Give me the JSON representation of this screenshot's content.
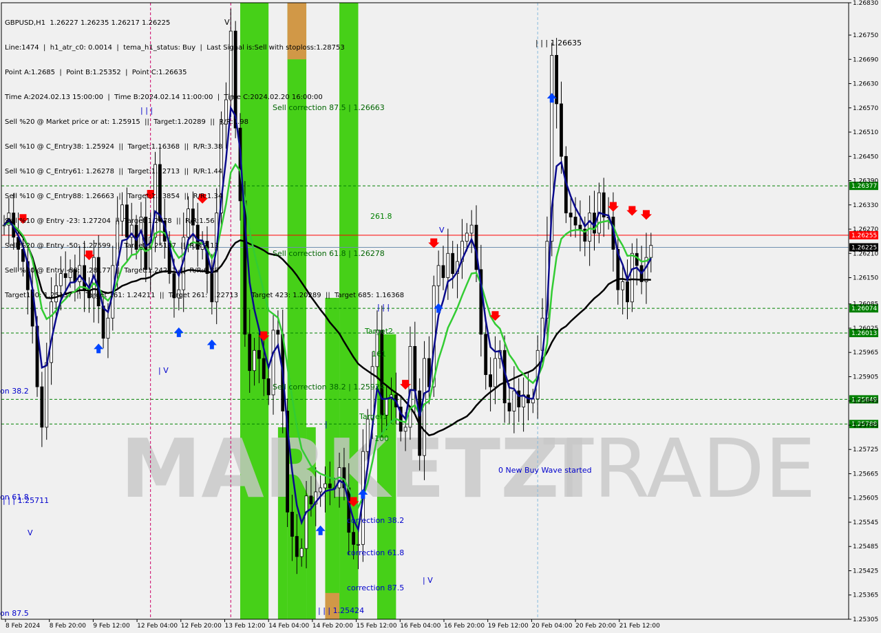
{
  "header": {
    "symbol_line": "GBPUSD,H1  1.26227 1.26235 1.26217 1.26225",
    "info_lines": [
      "Line:1474  |  h1_atr_c0: 0.0014  |  tema_h1_status: Buy  |  Last Signal is:Sell with stoploss:1.28753",
      "Point A:1.2685  |  Point B:1.25352  |  Point C:1.26635",
      "Time A:2024.02.13 15:00:00  |  Time B:2024.02.14 11:00:00  |  Time C:2024.02.20 16:00:00",
      "Sell %20 @ Market price or at: 1.25915  ||  Target:1.20289  ||  R/R:1.98",
      "Sell %10 @ C_Entry38: 1.25924  ||  Target:1.16368  ||  R/R:3.38",
      "Sell %10 @ C_Entry61: 1.26278  ||  Target:1.22713  ||  R/R:1.44",
      "Sell %10 @ C_Entry88: 1.26663  ||  Target:1.23854  ||  R/R:1.34",
      "Sell %10 @ Entry -23: 1.27204  ||  Target:1.2478  ||  R/R:1.56",
      "Sell %20 @ Entry -50: 1.27599  ||  Target:1.25137  ||  R/R:2.13",
      "Sell %20 @ Entry -88: 1.28177  ||  Target:1.24211  ||  R/R:6.89",
      "Target100: 1.25137  ||  Target 161: 1.24211  ||  Target 261: 1.22713  ||  Target 423: 1.20289  ||  Target 685: 1.16368"
    ]
  },
  "watermark": {
    "left": "MARKETZI",
    "right": "TRADE"
  },
  "colors": {
    "bull_candle": "#000000",
    "bear_candle": "#000000",
    "zone_green": "#33cc00",
    "zone_orange": "#d9954a",
    "ma_black": "#000000",
    "ma_navy": "#0a0a8c",
    "ma_green": "#33cc33",
    "level_green": "#008000",
    "level_red": "#ff0000",
    "level_grey": "#7090b0"
  },
  "annotations": [
    {
      "text": "Sell correction 87.5 | 1.26663",
      "color": "#006400"
    },
    {
      "text": "Sell correction 61.8 | 1.26278",
      "color": "#006400"
    },
    {
      "text": "Sell correction 38.2 | 1.25924",
      "color": "#006400"
    },
    {
      "text": "261.8",
      "color": "#008000"
    },
    {
      "text": "Target2",
      "color": "#008000"
    },
    {
      "text": "161",
      "color": "#008000"
    },
    {
      "text": "Target1",
      "color": "#008000"
    },
    {
      "text": "100",
      "color": "#008000"
    },
    {
      "text": "| | | 1.26635",
      "color": "#000000"
    },
    {
      "text": "| | | 1.25711",
      "color": "#0000cc"
    },
    {
      "text": "| | | 1.25424",
      "color": "#0000cc"
    },
    {
      "text": "0 New Buy Wave started",
      "color": "#0000cc"
    },
    {
      "text": "correction 38.2",
      "color": "#0000cc"
    },
    {
      "text": "correction 61.8",
      "color": "#0000cc"
    },
    {
      "text": "correction 87.5",
      "color": "#0000cc"
    },
    {
      "text": "on 38.2",
      "color": "#0000cc"
    },
    {
      "text": "on 61.8",
      "color": "#0000cc"
    },
    {
      "text": "on 87.5",
      "color": "#0000cc"
    },
    {
      "text": "| | |",
      "color": "#0000cc"
    },
    {
      "text": "| | |",
      "color": "#0000cc"
    },
    {
      "text": "| V",
      "color": "#0000cc"
    },
    {
      "text": "| V",
      "color": "#0000cc"
    },
    {
      "text": "V",
      "color": "#0000cc"
    },
    {
      "text": "V",
      "color": "#0000cc"
    },
    {
      "text": "V",
      "color": "#000000"
    },
    {
      "text": "|",
      "color": "#0000cc"
    }
  ],
  "chart_data": {
    "type": "candlestick",
    "symbol": "GBPUSD",
    "timeframe": "H1",
    "y_ticks": [
      "1.26830",
      "1.26750",
      "1.26690",
      "1.26630",
      "1.26570",
      "1.26510",
      "1.26450",
      "1.26390",
      "1.26330",
      "1.26270",
      "1.26210",
      "1.26150",
      "1.26085",
      "1.26025",
      "1.25965",
      "1.25905",
      "1.25845",
      "1.25785",
      "1.25725",
      "1.25665",
      "1.25605",
      "1.25545",
      "1.25485",
      "1.25425",
      "1.25365",
      "1.25305"
    ],
    "ylim": [
      1.25305,
      1.2683
    ],
    "x_ticks": [
      "8 Feb 2024",
      "8 Feb 20:00",
      "9 Feb 12:00",
      "12 Feb 04:00",
      "12 Feb 20:00",
      "13 Feb 12:00",
      "14 Feb 04:00",
      "14 Feb 20:00",
      "15 Feb 12:00",
      "16 Feb 04:00",
      "16 Feb 20:00",
      "19 Feb 12:00",
      "20 Feb 04:00",
      "20 Feb 20:00",
      "21 Feb 12:00"
    ],
    "price_levels": [
      {
        "label": "1.26377",
        "value": 1.26377,
        "color": "#008000"
      },
      {
        "label": "1.26255",
        "value": 1.26255,
        "color": "#ff0000"
      },
      {
        "label": "1.26225",
        "value": 1.26225,
        "color": "#000000"
      },
      {
        "label": "1.26074",
        "value": 1.26074,
        "color": "#008000"
      },
      {
        "label": "1.26013",
        "value": 1.26013,
        "color": "#008000"
      },
      {
        "label": "1.25849",
        "value": 1.25849,
        "color": "#008000"
      },
      {
        "label": "1.25788",
        "value": 1.25788,
        "color": "#008000"
      }
    ],
    "zones": [
      {
        "t0": 50,
        "t1": 56,
        "y0": 1.25305,
        "y1": 1.2683,
        "color": "green"
      },
      {
        "t0": 60,
        "t1": 64,
        "y0": 1.25305,
        "y1": 1.2683,
        "color": "green"
      },
      {
        "t0": 60,
        "t1": 64,
        "y0": 1.2669,
        "y1": 1.2683,
        "color": "orange"
      },
      {
        "t0": 71,
        "t1": 75,
        "y0": 1.25305,
        "y1": 1.2683,
        "color": "green"
      },
      {
        "t0": 68,
        "t1": 71,
        "y0": 1.25305,
        "y1": 1.261,
        "color": "green"
      },
      {
        "t0": 79,
        "t1": 83,
        "y0": 1.25305,
        "y1": 1.2601,
        "color": "green"
      },
      {
        "t0": 68,
        "t1": 71,
        "y0": 1.25305,
        "y1": 1.2537,
        "color": "orange"
      },
      {
        "t0": 58,
        "t1": 60,
        "y0": 1.25305,
        "y1": 1.2578,
        "color": "green"
      },
      {
        "t0": 64,
        "t1": 66,
        "y0": 1.25305,
        "y1": 1.2578,
        "color": "green"
      }
    ],
    "close": [
      1.2628,
      1.2631,
      1.2625,
      1.2622,
      1.2619,
      1.2612,
      1.2603,
      1.2588,
      1.2578,
      1.2594,
      1.2609,
      1.2613,
      1.2616,
      1.2615,
      1.2617,
      1.2614,
      1.2618,
      1.2612,
      1.261,
      1.262,
      1.2608,
      1.26,
      1.2605,
      1.2618,
      1.2629,
      1.2633,
      1.2625,
      1.2628,
      1.2622,
      1.263,
      1.2617,
      1.2625,
      1.2643,
      1.2629,
      1.2624,
      1.2616,
      1.261,
      1.2612,
      1.2625,
      1.2632,
      1.2628,
      1.2622,
      1.2624,
      1.2616,
      1.2609,
      1.2631,
      1.2653,
      1.2659,
      1.2676,
      1.2652,
      1.2634,
      1.2601,
      1.2592,
      1.2597,
      1.2595,
      1.259,
      1.2586,
      1.2602,
      1.2601,
      1.2582,
      1.2557,
      1.2551,
      1.2546,
      1.2548,
      1.2561,
      1.2559,
      1.2562,
      1.2563,
      1.2564,
      1.2563,
      1.2563,
      1.2568,
      1.2563,
      1.2552,
      1.2549,
      1.2549,
      1.2572,
      1.258,
      1.2593,
      1.2602,
      1.2581,
      1.2585,
      1.2586,
      1.2583,
      1.2577,
      1.2578,
      1.2598,
      1.2587,
      1.2571,
      1.2595,
      1.2588,
      1.2613,
      1.2618,
      1.2615,
      1.2621,
      1.2616,
      1.2619,
      1.2624,
      1.2626,
      1.2628,
      1.2617,
      1.2601,
      1.2591,
      1.2588,
      1.2595,
      1.2597,
      1.2584,
      1.2582,
      1.2587,
      1.2583,
      1.2586,
      1.2584,
      1.2585,
      1.2597,
      1.2605,
      1.2624,
      1.267,
      1.2658,
      1.2645,
      1.2631,
      1.263,
      1.2628,
      1.2627,
      1.2624,
      1.2631,
      1.2626,
      1.2636,
      1.263,
      1.263,
      1.2622,
      1.2612,
      1.2614,
      1.2609,
      1.2621,
      1.2618,
      1.2614,
      1.262,
      1.2623
    ]
  }
}
